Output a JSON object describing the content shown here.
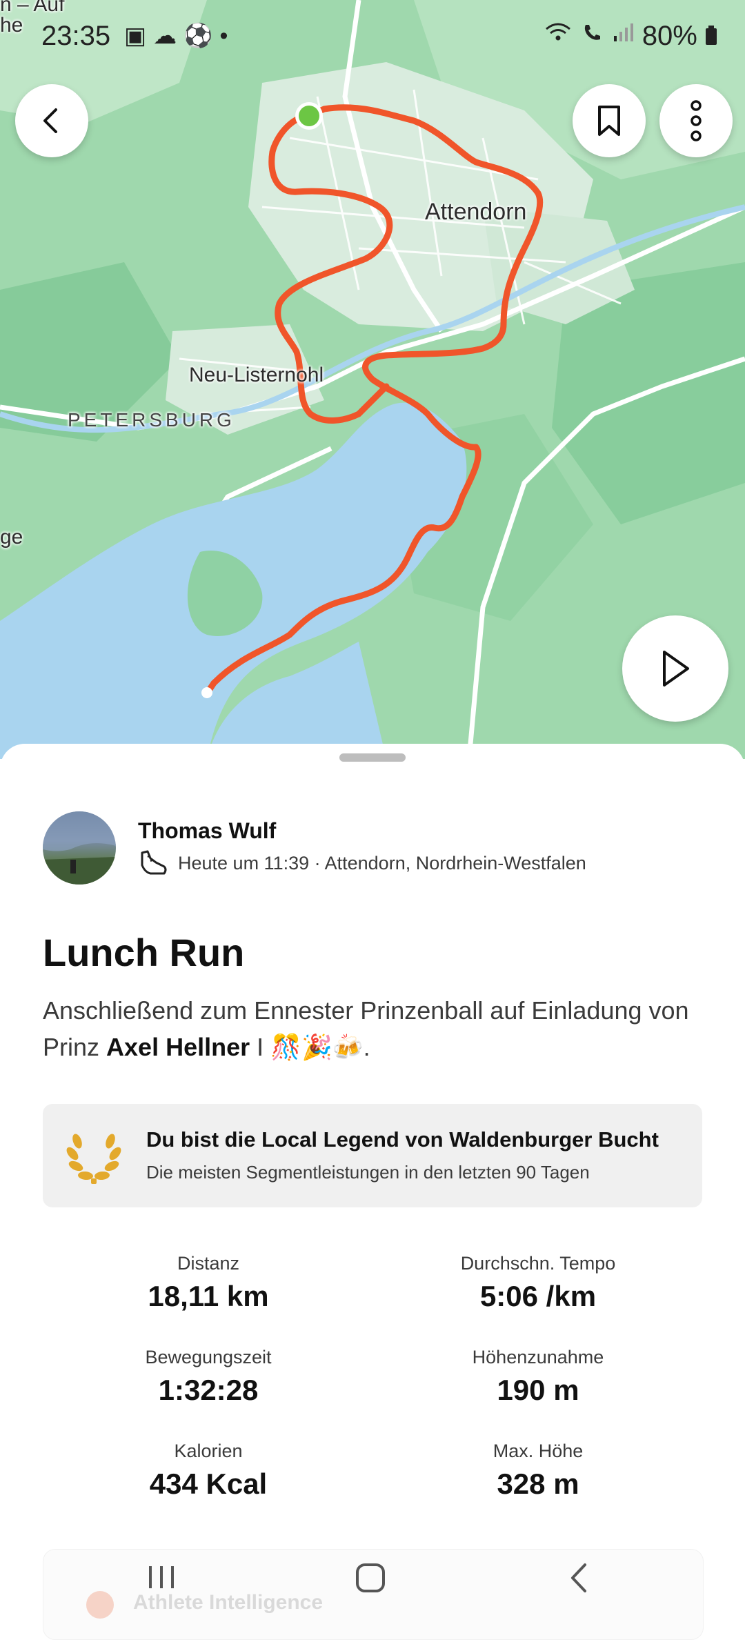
{
  "status_bar": {
    "time": "23:35",
    "battery": "80%"
  },
  "map": {
    "labels": {
      "corner_a": "n – Auf",
      "corner_b": "he",
      "attendorn": "Attendorn",
      "neu_listernohl": "Neu-Listernohl",
      "petersburg": "PETERSBURG",
      "left_edge": "ge"
    }
  },
  "athlete": {
    "name": "Thomas Wulf",
    "meta": "Heute um 11:39 · Attendorn, Nordrhein-Westfalen"
  },
  "activity": {
    "title": "Lunch Run",
    "description_prefix": "Anschließend zum Ennester Prinzenball auf Einladung von Prinz ",
    "description_bold": "Axel Hellner",
    "description_suffix": " I 🎊🎉🍻."
  },
  "local_legend": {
    "title": "Du bist die Local Legend von Waldenburger Bucht",
    "subtitle": "Die meisten Segmentleistungen in den letzten 90 Tagen"
  },
  "stats": [
    {
      "label": "Distanz",
      "value": "18,11 km"
    },
    {
      "label": "Durchschn. Tempo",
      "value": "5:06 /km"
    },
    {
      "label": "Bewegungszeit",
      "value": "1:32:28"
    },
    {
      "label": "Höhenzunahme",
      "value": "190 m"
    },
    {
      "label": "Kalorien",
      "value": "434 Kcal"
    },
    {
      "label": "Max. Höhe",
      "value": "328 m"
    }
  ],
  "peek_card": {
    "label": "Athlete Intelligence"
  },
  "colors": {
    "route": "#f0552a",
    "water": "#a9d4ef",
    "land": "#9fd8ad",
    "start_dot": "#6cc644",
    "laurel": "#e3a92c"
  }
}
